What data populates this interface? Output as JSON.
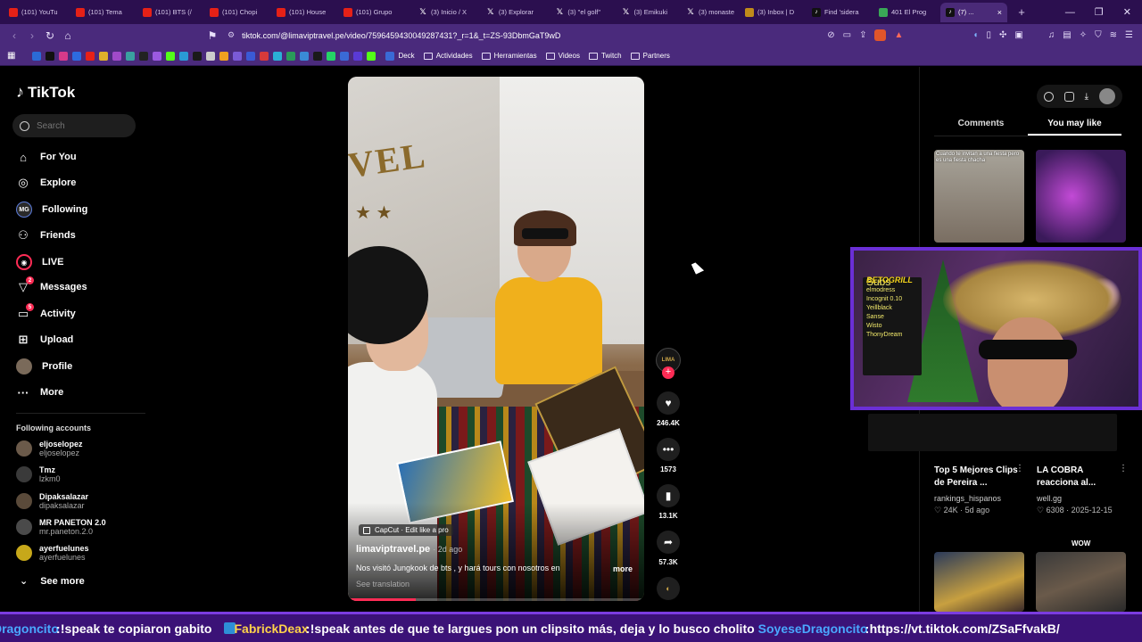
{
  "browser": {
    "tabs": [
      {
        "icon": "youtube-icon",
        "label": "(101) YouTu"
      },
      {
        "icon": "youtube-icon",
        "label": "(101) Tema"
      },
      {
        "icon": "youtube-icon",
        "label": "(101) BTS (/"
      },
      {
        "icon": "youtube-icon",
        "label": "(101) Chopi"
      },
      {
        "icon": "youtube-icon",
        "label": "(101) House"
      },
      {
        "icon": "youtube-icon",
        "label": "(101) Grupo"
      },
      {
        "icon": "x-icon",
        "label": "(3) Inicio / X"
      },
      {
        "icon": "x-icon",
        "label": "(3) Explorar"
      },
      {
        "icon": "x-icon",
        "label": "(3) \"el golf\""
      },
      {
        "icon": "x-icon",
        "label": "(3) Emikuki"
      },
      {
        "icon": "x-icon",
        "label": "(3) monaste"
      },
      {
        "icon": "inbox-icon",
        "label": "(3) Inbox | D"
      },
      {
        "icon": "tiktok-icon",
        "label": "Find 'sidera"
      },
      {
        "icon": "maps-icon",
        "label": "401 El Prog"
      },
      {
        "icon": "tiktok-icon",
        "label": "(7) ..."
      }
    ],
    "url": "tiktok.com/@limaviptravel.pe/video/7596459430049287431?_r=1&_t=ZS-93DbmGaT9wD",
    "bookmarks": [
      "Deck",
      "Actividades",
      "Herramientas",
      "Videos",
      "Twitch",
      "Partners"
    ]
  },
  "sidebar": {
    "logo": "TikTok",
    "search_placeholder": "Search",
    "nav": [
      {
        "label": "For You",
        "icon": "home-icon"
      },
      {
        "label": "Explore",
        "icon": "compass-icon"
      },
      {
        "label": "Following",
        "icon": "following-avatar",
        "avatar_text": "MG"
      },
      {
        "label": "Friends",
        "icon": "friends-icon"
      },
      {
        "label": "LIVE",
        "icon": "live-icon"
      },
      {
        "label": "Messages",
        "icon": "messages-icon",
        "badge": "2"
      },
      {
        "label": "Activity",
        "icon": "activity-icon",
        "badge": "5"
      },
      {
        "label": "Upload",
        "icon": "upload-icon"
      },
      {
        "label": "Profile",
        "icon": "profile-avatar"
      },
      {
        "label": "More",
        "icon": "more-icon"
      }
    ],
    "following_title": "Following accounts",
    "accounts": [
      {
        "name": "eljoselopez",
        "handle": "eljoselopez",
        "color": "#6b5a4a"
      },
      {
        "name": "Tmz",
        "handle": "lzkm0",
        "color": "#3a3a3a"
      },
      {
        "name": "Dipaksalazar",
        "handle": "dipaksalazar",
        "color": "#5a4a3a"
      },
      {
        "name": "MR PANETON 2.0",
        "handle": "mr.paneton.2.0",
        "color": "#4a4a4a"
      },
      {
        "name": "ayerfuelunes",
        "handle": "ayerfuelunes",
        "color": "#c7a81a"
      }
    ],
    "see_more": "See more"
  },
  "video": {
    "capcut_label": "CapCut · Edit like a pro",
    "author": "limaviptravel.pe",
    "ago": "· 2d ago",
    "description": "Nos visitó Jungkook de bts , y hará tours con nosotros en",
    "more": "more",
    "see_translation": "See translation",
    "scene_sign": "VEL",
    "creator_avatar_text": "LIMA",
    "progress": 0.23,
    "likes": "246.4K",
    "comments": "1573",
    "saves": "13.1K",
    "shares": "57.3K"
  },
  "right_panel": {
    "tabs": [
      "Comments",
      "You may like"
    ],
    "active_tab": "You may like",
    "thumb_caption": "Cuando te invitan a una fiesta pero es una fiesta chacha",
    "videos": [
      {
        "title": "Top 5 Mejores Clips de Pereira ...",
        "author": "rankings_hispanos",
        "likes": "24K",
        "date": "5d ago"
      },
      {
        "title": "LA COBRA reacciona al...",
        "author": "well.gg",
        "likes": "6308",
        "date": "2025-12-15"
      }
    ],
    "wow_label": "WOW"
  },
  "webcam": {
    "brand": "BETOGRILL",
    "board_lines": [
      "Subs",
      "elmodress",
      "Incognit 0.10",
      "Yeillblack",
      "Sanse",
      "Wisto",
      "ThonyDream"
    ]
  },
  "ticker": [
    {
      "user": "Dragoncito",
      "msg": "!speak te copiaron gabito",
      "color": "blue"
    },
    {
      "user": "FabrickDeax",
      "msg": "!speak antes de que te largues pon un clipsito más, deja y lo busco cholito",
      "color": "gold"
    },
    {
      "user": "SoyeseDragoncito",
      "msg": "https://vt.tiktok.com/ZSaFfvakB/",
      "color": "blue"
    }
  ]
}
